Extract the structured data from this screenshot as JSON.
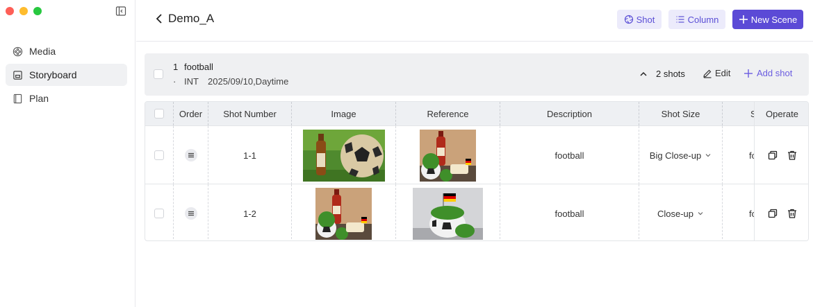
{
  "sidebar": {
    "items": [
      {
        "label": "Media",
        "icon": "film-reel-icon"
      },
      {
        "label": "Storyboard",
        "icon": "storyboard-icon",
        "active": true
      },
      {
        "label": "Plan",
        "icon": "document-icon"
      }
    ]
  },
  "header": {
    "title": "Demo_A",
    "shot_label": "Shot",
    "column_label": "Column",
    "new_scene_label": "New Scene"
  },
  "scene": {
    "number": "1",
    "title": "football",
    "separator": "·",
    "int_ext": "INT",
    "date_time": "2025/09/10,Daytime",
    "shot_count": "2 shots",
    "edit_label": "Edit",
    "add_shot_label": "Add shot"
  },
  "table": {
    "headers": {
      "order": "Order",
      "shot_number": "Shot Number",
      "image": "Image",
      "reference": "Reference",
      "description": "Description",
      "shot_size": "Shot Size",
      "partial": "S",
      "operate": "Operate"
    },
    "rows": [
      {
        "shot_number": "1-1",
        "image": "beer-bottle-and-football-on-grass",
        "reference": "beer-bottle-with-grass-football-and-german-flag",
        "description": "football",
        "shot_size": "Big Close-up",
        "partial": "fo"
      },
      {
        "shot_number": "1-2",
        "image": "beer-bottle-with-grass-football-and-german-flag",
        "reference": "grass-football-with-german-flag",
        "description": "football",
        "shot_size": "Close-up",
        "partial": "fo"
      }
    ]
  },
  "colors": {
    "accent": "#5b4ad6",
    "accent_light": "#ecebfb",
    "header_bg": "#eef0f3"
  }
}
